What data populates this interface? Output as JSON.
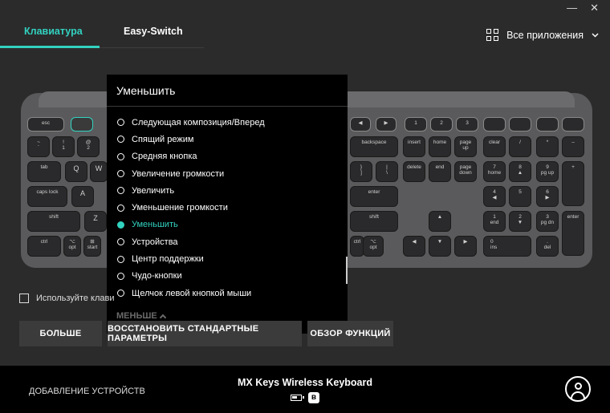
{
  "window": {
    "minimize": "—",
    "close": "✕"
  },
  "tabs": [
    {
      "label": "Клавиатура",
      "active": true
    },
    {
      "label": "Easy-Switch",
      "active": false
    }
  ],
  "apps_selector": {
    "label": "Все приложения",
    "icon": "grid-icon"
  },
  "dropdown": {
    "title": "Уменьшить",
    "items": [
      {
        "label": "Следующая композиция/Вперед"
      },
      {
        "label": "Спящий режим"
      },
      {
        "label": "Средняя кнопка"
      },
      {
        "label": "Увеличение громкости"
      },
      {
        "label": "Увеличить"
      },
      {
        "label": "Уменьшение громкости"
      },
      {
        "label": "Уменьшить",
        "selected": true
      },
      {
        "label": "Устройства"
      },
      {
        "label": "Центр поддержки"
      },
      {
        "label": "Чудо-кнопки"
      },
      {
        "label": "Щелчок левой кнопкой мыши"
      }
    ],
    "less_label": "МЕНЬШЕ"
  },
  "use_keys_label": "Используйте клави",
  "buttons": {
    "more": "БОЛЬШЕ",
    "restore": "ВОССТАНОВИТЬ СТАНДАРТНЫЕ ПАРАМЕТРЫ",
    "overview": "ОБЗОР ФУНКЦИЙ"
  },
  "footer": {
    "add_devices": "ДОБАВЛЕНИЕ УСТРОЙСТВ",
    "device_name": "MX Keys Wireless Keyboard"
  },
  "keys": {
    "esc": "esc",
    "tilde": "~\n`",
    "one": "!\n1",
    "two": "@\n2",
    "tab": "tab",
    "q": "Q",
    "w": "W",
    "caps": "caps lock",
    "a": "A",
    "shift_l": "shift",
    "z": "Z",
    "ctrl_l": "ctrl",
    "opt_l": "⌥\nopt",
    "start": "⊞\nstart",
    "backspace": "backspace",
    "insert": "insert",
    "home": "home",
    "pgup": "page\nup",
    "clear": "clear",
    "slash": "/",
    "star": "*",
    "minus": "–",
    "bracket_r": "}\n]",
    "backslash": "|\n\\",
    "delete": "delete",
    "end": "end",
    "pgdn": "page\ndown",
    "n7": "7\nhome",
    "n8": "8\n▲",
    "n9": "9\npg up",
    "plus": "+",
    "enter": "enter",
    "n4": "4\n◀",
    "n5": "5",
    "n6": "6\n▶",
    "shift_r": "shift",
    "up": "▲",
    "n1": "1\nend",
    "n2": "2\n▼",
    "n3": "3\npg dn",
    "enter_np": "enter",
    "ctrl_r": "ctrl",
    "opt_r": "⌥\nopt",
    "left": "◀",
    "down": "▼",
    "right": "▶",
    "n0": "0\nins",
    "dot": ".\ndel",
    "f_dec": "◀",
    "f_inc": "▶",
    "e1": "1",
    "e2": "2",
    "e3": "3"
  }
}
